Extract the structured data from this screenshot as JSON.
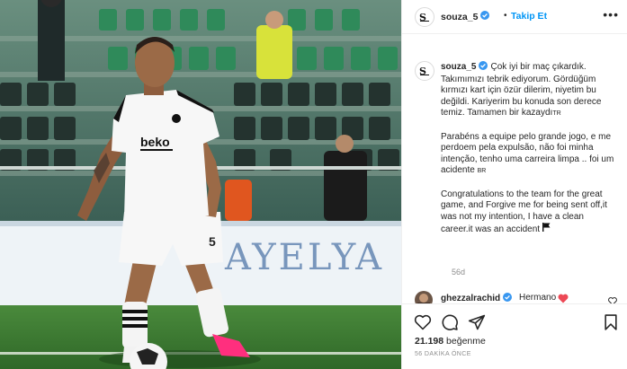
{
  "post": {
    "username": "souza_5",
    "follow_label": "Takip Et",
    "separator": "•",
    "more_label": "•••"
  },
  "caption": {
    "username": "souza_5",
    "tr_text": "Çok iyi bir maç çıkardık. Takımımızı tebrik ediyorum. Gördüğüm kırmızı kart için özür dilerim, niyetim bu değildi. Kariyerim bu konuda son derece temiz. Tamamen bir kazaydı",
    "tr_tag": "TR",
    "pt_text": "Parabéns a equipe pelo grande jogo, e me perdoem pela expulsão, não foi minha intenção, tenho uma carreira limpa .. foi um acidente",
    "pt_tag": "BR",
    "en_text": "Congratulations to the team for the great game, and Forgive me for being sent off,it was not my intention, I have a clean career.it was an accident",
    "time": "56d"
  },
  "comment": {
    "username": "ghezzalrachid",
    "text": "Hermano"
  },
  "actions": {
    "likes_count": "21.198",
    "likes_word": "beğenme",
    "posted_ago": "56 DAKİKA ÖNCE"
  },
  "photo": {
    "shirt_text": "beko",
    "banner_text": "AYELYA",
    "number": "5"
  },
  "colors": {
    "accent": "#0095f6",
    "verified": "#3897f0",
    "heart": "#ed4956",
    "pitch": "#3f7d35",
    "cleat": "#ff2f7e"
  }
}
